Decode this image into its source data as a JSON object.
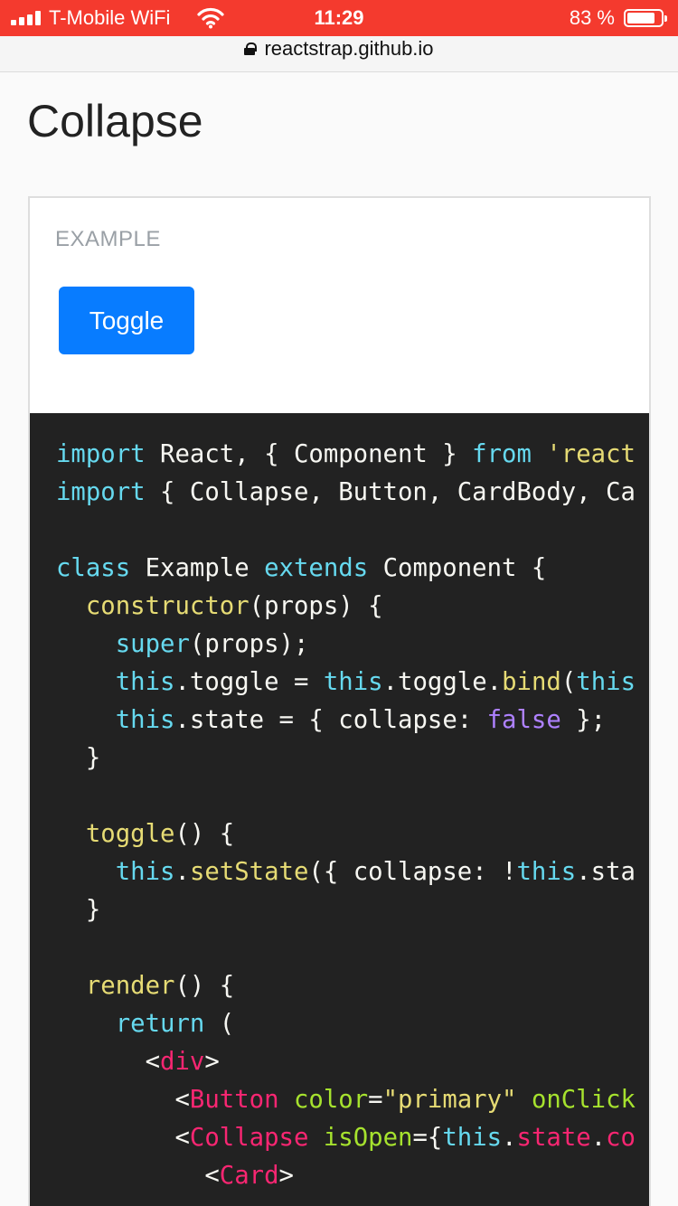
{
  "status_bar": {
    "carrier": "T-Mobile WiFi",
    "time": "11:29",
    "battery_percent": "83 %",
    "battery_level": 0.83,
    "icons": [
      "signal-icon",
      "wifi-icon",
      "battery-icon"
    ]
  },
  "browser": {
    "url": "reactstrap.github.io",
    "lock_icon": "lock-icon"
  },
  "page": {
    "title": "Collapse"
  },
  "example": {
    "label": "EXAMPLE",
    "toggle_button": "Toggle"
  },
  "code": {
    "lines": [
      {
        "s": [
          [
            "k",
            "import"
          ],
          [
            "p",
            " React, { Component } "
          ],
          [
            "k",
            "from"
          ],
          [
            "p",
            " "
          ],
          [
            "s",
            "'react"
          ]
        ]
      },
      {
        "s": [
          [
            "k",
            "import"
          ],
          [
            "p",
            " { Collapse, Button, CardBody, Ca"
          ]
        ]
      },
      {
        "s": []
      },
      {
        "s": [
          [
            "k",
            "class"
          ],
          [
            "p",
            " Example "
          ],
          [
            "k",
            "extends"
          ],
          [
            "p",
            " Component {"
          ]
        ]
      },
      {
        "s": [
          [
            "p",
            "  "
          ],
          [
            "f",
            "constructor"
          ],
          [
            "p",
            "(props) {"
          ]
        ]
      },
      {
        "s": [
          [
            "p",
            "    "
          ],
          [
            "k",
            "super"
          ],
          [
            "p",
            "(props);"
          ]
        ]
      },
      {
        "s": [
          [
            "p",
            "    "
          ],
          [
            "k",
            "this"
          ],
          [
            "p",
            ".toggle = "
          ],
          [
            "k",
            "this"
          ],
          [
            "p",
            ".toggle."
          ],
          [
            "f",
            "bind"
          ],
          [
            "p",
            "("
          ],
          [
            "k",
            "this"
          ]
        ]
      },
      {
        "s": [
          [
            "p",
            "    "
          ],
          [
            "k",
            "this"
          ],
          [
            "p",
            ".state = { collapse: "
          ],
          [
            "b",
            "false"
          ],
          [
            "p",
            " };"
          ]
        ]
      },
      {
        "s": [
          [
            "p",
            "  }"
          ]
        ]
      },
      {
        "s": []
      },
      {
        "s": [
          [
            "p",
            "  "
          ],
          [
            "f",
            "toggle"
          ],
          [
            "p",
            "() {"
          ]
        ]
      },
      {
        "s": [
          [
            "p",
            "    "
          ],
          [
            "k",
            "this"
          ],
          [
            "p",
            "."
          ],
          [
            "f",
            "setState"
          ],
          [
            "p",
            "({ collapse: !"
          ],
          [
            "k",
            "this"
          ],
          [
            "p",
            ".sta"
          ]
        ]
      },
      {
        "s": [
          [
            "p",
            "  }"
          ]
        ]
      },
      {
        "s": []
      },
      {
        "s": [
          [
            "p",
            "  "
          ],
          [
            "f",
            "render"
          ],
          [
            "p",
            "() {"
          ]
        ]
      },
      {
        "s": [
          [
            "p",
            "    "
          ],
          [
            "k",
            "return"
          ],
          [
            "p",
            " ("
          ]
        ]
      },
      {
        "s": [
          [
            "p",
            "      <"
          ],
          [
            "t",
            "div"
          ],
          [
            "p",
            ">"
          ]
        ]
      },
      {
        "s": [
          [
            "p",
            "        <"
          ],
          [
            "t",
            "Button"
          ],
          [
            "p",
            " "
          ],
          [
            "a",
            "color"
          ],
          [
            "p",
            "="
          ],
          [
            "s",
            "\"primary\""
          ],
          [
            "p",
            " "
          ],
          [
            "a",
            "onClick"
          ]
        ]
      },
      {
        "s": [
          [
            "p",
            "        <"
          ],
          [
            "t",
            "Collapse"
          ],
          [
            "p",
            " "
          ],
          [
            "a",
            "isOpen"
          ],
          [
            "p",
            "={"
          ],
          [
            "k",
            "this"
          ],
          [
            "p",
            "."
          ],
          [
            "t",
            "state"
          ],
          [
            "p",
            "."
          ],
          [
            "t",
            "co"
          ]
        ]
      },
      {
        "s": [
          [
            "p",
            "          <"
          ],
          [
            "t",
            "Card"
          ],
          [
            "p",
            ">"
          ]
        ]
      }
    ]
  },
  "colors": {
    "status_bar": "#f43a2e",
    "primary_button": "#087cff",
    "code_background": "#222222"
  }
}
